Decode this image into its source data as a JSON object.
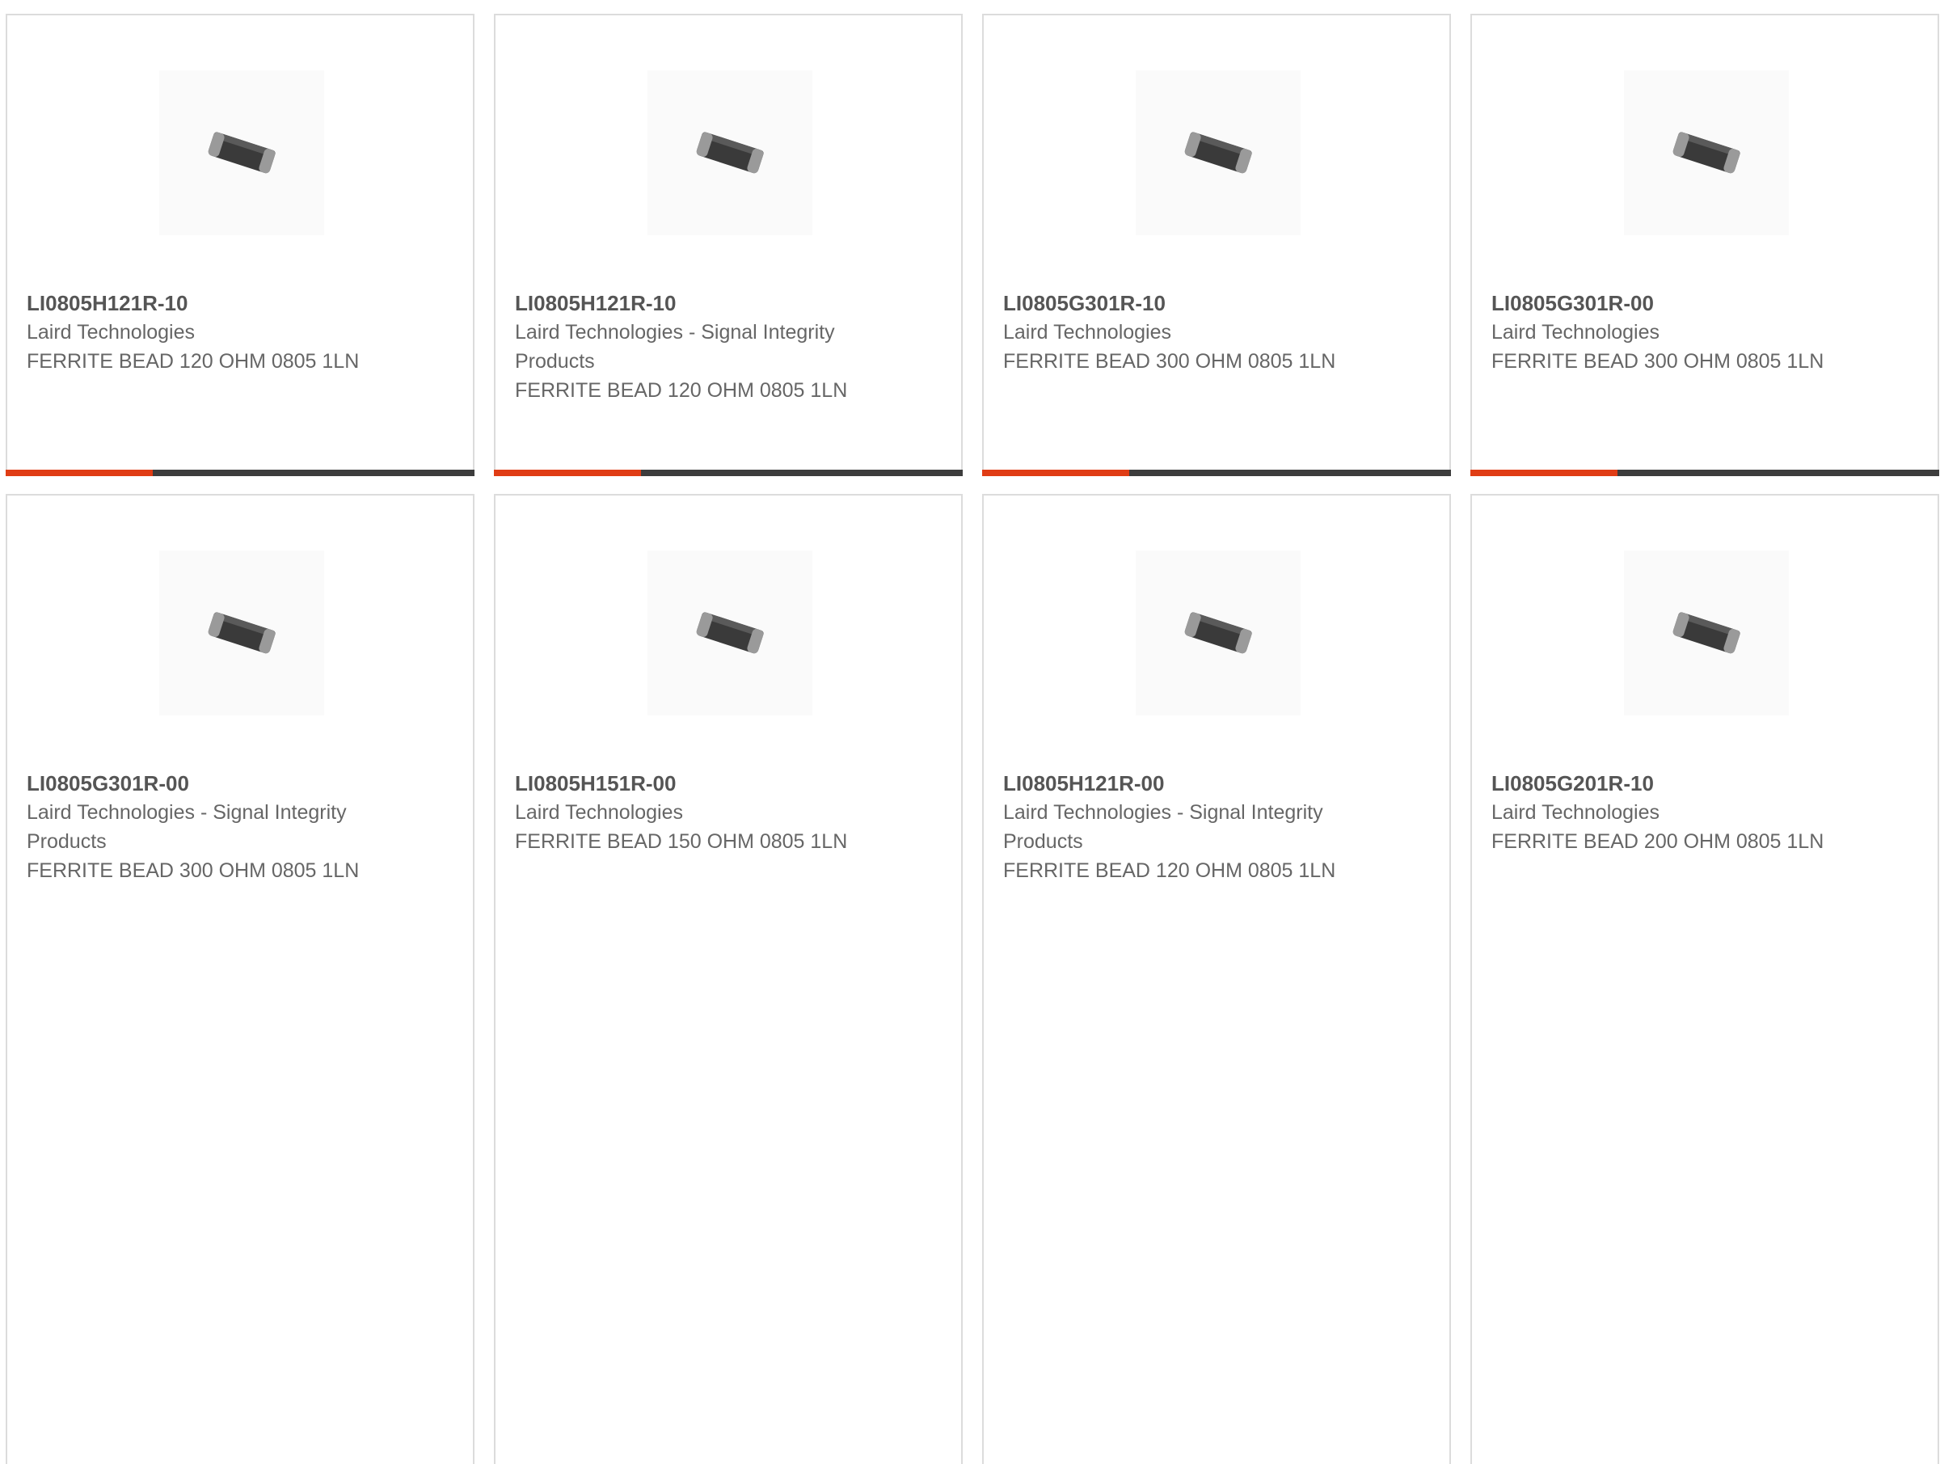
{
  "colors": {
    "accent": "#e03d15",
    "bar_dark": "#3d3d3d",
    "card_border": "#dcdcdc",
    "text": "#666666"
  },
  "products": [
    {
      "part": "LI0805H121R-10",
      "manufacturer": "Laird Technologies",
      "description": "FERRITE BEAD 120 OHM 0805 1LN",
      "image_icon": "ferrite-bead-chip-icon"
    },
    {
      "part": "LI0805H121R-10",
      "manufacturer": "Laird Technologies - Signal Integrity Products",
      "description": "FERRITE BEAD 120 OHM 0805 1LN",
      "image_icon": "ferrite-bead-chip-icon"
    },
    {
      "part": "LI0805G301R-10",
      "manufacturer": "Laird Technologies",
      "description": "FERRITE BEAD 300 OHM 0805 1LN",
      "image_icon": "ferrite-bead-chip-icon"
    },
    {
      "part": "LI0805G301R-00",
      "manufacturer": "Laird Technologies",
      "description": "FERRITE BEAD 300 OHM 0805 1LN",
      "image_icon": "ferrite-bead-chip-icon"
    },
    {
      "part": "LI0805G301R-00",
      "manufacturer": "Laird Technologies - Signal Integrity Products",
      "description": "FERRITE BEAD 300 OHM 0805 1LN",
      "image_icon": "ferrite-bead-chip-icon"
    },
    {
      "part": "LI0805H151R-00",
      "manufacturer": "Laird Technologies",
      "description": "FERRITE BEAD 150 OHM 0805 1LN",
      "image_icon": "ferrite-bead-chip-icon"
    },
    {
      "part": "LI0805H121R-00",
      "manufacturer": "Laird Technologies - Signal Integrity Products",
      "description": "FERRITE BEAD 120 OHM 0805 1LN",
      "image_icon": "ferrite-bead-chip-icon"
    },
    {
      "part": "LI0805G201R-10",
      "manufacturer": "Laird Technologies",
      "description": "FERRITE BEAD 200 OHM 0805 1LN",
      "image_icon": "ferrite-bead-chip-icon"
    }
  ]
}
